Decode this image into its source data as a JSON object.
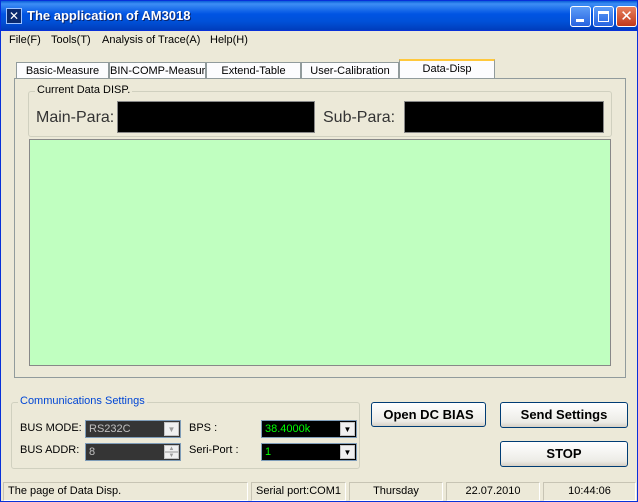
{
  "window": {
    "title": "The application of AM3018"
  },
  "menu": [
    "File(F)",
    "Tools(T)",
    "Analysis of Trace(A)",
    "Help(H)"
  ],
  "tabs": [
    "Basic-Measure",
    "BIN-COMP-Measure",
    "Extend-Table",
    "User-Calibration",
    "Data-Disp"
  ],
  "active_tab": "Data-Disp",
  "display": {
    "group_title": "Current Data DISP.",
    "main_label": "Main-Para:",
    "main_value": "",
    "sub_label": "Sub-Para:",
    "sub_value": "",
    "area_color": "#c0ffc0"
  },
  "comm": {
    "title": "Communications Settings",
    "bus_mode_label": "BUS MODE:",
    "bus_mode_value": "RS232C",
    "bus_addr_label": "BUS ADDR:",
    "bus_addr_value": "8",
    "bps_label": "BPS :",
    "bps_value": "38.4000k",
    "port_label": "Seri-Port :",
    "port_value": "1"
  },
  "buttons": {
    "open_dc_bias": "Open DC BIAS",
    "send_settings": "Send Settings",
    "stop": "STOP"
  },
  "status": {
    "page": "The page of Data Disp.",
    "serial_port": "Serial port:COM1",
    "day": "Thursday",
    "date": "22.07.2010",
    "time": "10:44:06"
  },
  "colors": {
    "titlebar": "#0054e3",
    "value_green": "#00ff00",
    "value_gray": "#c0c0c0",
    "comm_title": "#0046d5"
  }
}
